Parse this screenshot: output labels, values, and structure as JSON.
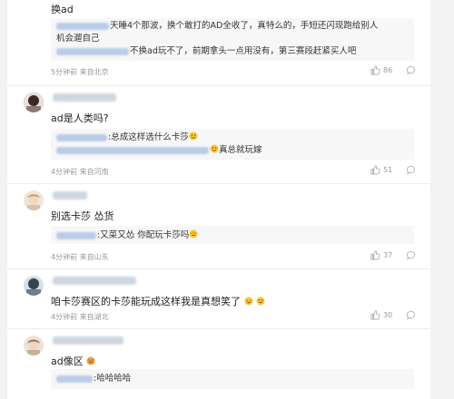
{
  "comments": [
    {
      "text": "换ad",
      "replies": [
        {
          "text": "天睡4个那波，换个敢打的AD全收了，真特么的，手短还闪现跑给别人"
        },
        {
          "text": "机会遛自己"
        },
        {
          "text": "不换ad玩不了，前期拿头一点用没有，第三赛段赶紧买人吧"
        }
      ],
      "time": "5分钟前",
      "location": "来自北京",
      "likes": "86"
    },
    {
      "text": "ad是人类吗?",
      "replies": [
        {
          "text": ":总成这样选什么卡莎"
        },
        {
          "text": "真总就玩嫁"
        }
      ],
      "time": "4分钟前",
      "location": "来自河南",
      "likes": "51"
    },
    {
      "text": "别选卡莎 怂货",
      "replies": [
        {
          "text": ":又菜又怂 你配玩卡莎吗"
        }
      ],
      "time": "4分钟前",
      "location": "来自山东",
      "likes": "37"
    },
    {
      "text": "咱卡莎赛区的卡莎能玩成这样我是真想笑了",
      "time": "4分钟前",
      "location": "来自湖北",
      "likes": "30"
    },
    {
      "text": "ad像区",
      "replies": [
        {
          "text": ":哈哈哈哈"
        }
      ]
    }
  ],
  "colors": {
    "blurred_username": "#b9cde6",
    "meta_text": "#999999",
    "reply_background": "#f7f7f8"
  },
  "icons": [
    "comment-icon",
    "like-icon",
    "emoji-icon"
  ]
}
